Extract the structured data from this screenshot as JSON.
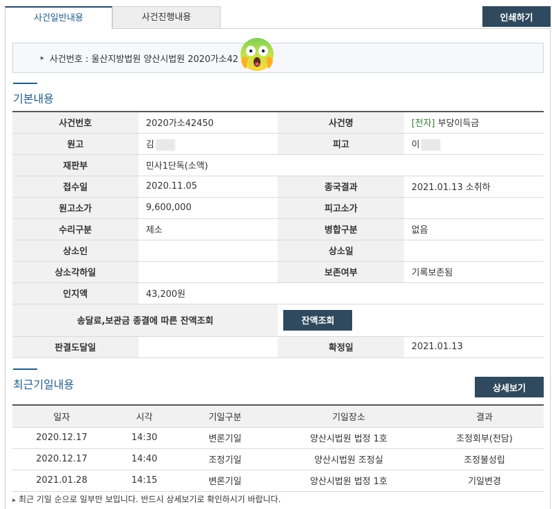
{
  "tabs": [
    {
      "label": "사건일반내용",
      "active": true
    },
    {
      "label": "사건진행내용",
      "active": false
    }
  ],
  "print_button": "인쇄하기",
  "case_line": "사건번호 : 울산지방법원 양산시법원 2020가소42",
  "basic_title": "기본내용",
  "basic": {
    "case_no_label": "사건번호",
    "case_no": "2020가소42450",
    "case_name_label": "사건명",
    "case_name_tag": "[전자]",
    "case_name": "부당이득금",
    "plaintiff_label": "원고",
    "plaintiff": "김",
    "defendant_label": "피고",
    "defendant": "이",
    "court_label": "재판부",
    "court": "민사1단독(소액)",
    "filed_label": "접수일",
    "filed": "2020.11.05",
    "final_result_label": "종국결과",
    "final_result": "2021.01.13 소취하",
    "plaintiff_value_label": "원고소가",
    "plaintiff_value": "9,600,000",
    "defendant_value_label": "피고소가",
    "defendant_value": "",
    "receipt_type_label": "수리구분",
    "receipt_type": "제소",
    "merge_label": "병합구분",
    "merge": "없음",
    "appellant_label": "상소인",
    "appellant": "",
    "appeal_date_label": "상소일",
    "appeal_date": "",
    "appeal_dismiss_label": "상소각하일",
    "appeal_dismiss": "",
    "preserve_label": "보존여부",
    "preserve": "기록보존됨",
    "stamp_label": "인지액",
    "stamp": "43,200원",
    "balance_label": "송달료,보관금 종결에 따른 잔액조회",
    "balance_button": "잔액조회",
    "judgment_arrival_label": "판결도달일",
    "judgment_arrival": "",
    "confirmed_label": "확정일",
    "confirmed": "2021.01.13"
  },
  "recent_title": "최근기일내용",
  "detail_button": "상세보기",
  "hearings": {
    "headers": [
      "일자",
      "시각",
      "기일구분",
      "기일장소",
      "결과"
    ],
    "rows": [
      [
        "2020.12.17",
        "14:30",
        "변론기일",
        "양산시법원 법정 1호",
        "조정회부(전담)"
      ],
      [
        "2020.12.17",
        "14:40",
        "조정기일",
        "양산시법원 조정실",
        "조정불성립"
      ],
      [
        "2021.01.28",
        "14:15",
        "변론기일",
        "양산시법원 법정 1호",
        "기일변경"
      ]
    ]
  },
  "note": "최근 기일 순으로 일부만 보입니다. 반드시 상세보기로 확인하시기 바랍니다.",
  "colors": {
    "accent": "#1f5c8a",
    "button": "#2f4a5e",
    "electron": "#2e7d32"
  }
}
